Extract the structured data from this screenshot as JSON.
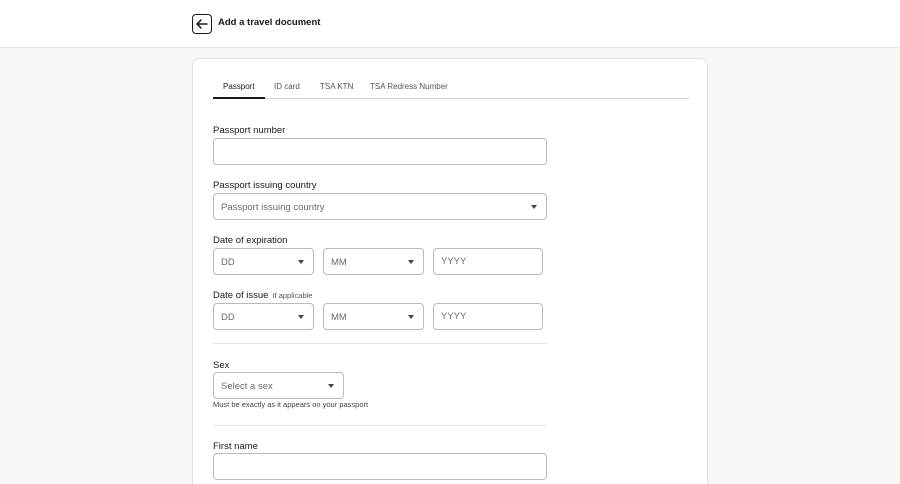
{
  "header": {
    "back_icon": "arrow-left-icon",
    "title": "Add a travel document"
  },
  "tabs": [
    {
      "label": "Passport",
      "active": true
    },
    {
      "label": "ID card",
      "active": false
    },
    {
      "label": "TSA KTN",
      "active": false
    },
    {
      "label": "TSA Redress Number",
      "active": false
    }
  ],
  "form": {
    "passport_number": {
      "label": "Passport number",
      "value": ""
    },
    "issuing_country": {
      "label": "Passport issuing country",
      "selected": "Passport issuing country"
    },
    "expiration": {
      "label": "Date of expiration",
      "day": "DD",
      "month": "MM",
      "year_placeholder": "YYYY"
    },
    "issue": {
      "label": "Date of issue",
      "hint": "If applicable",
      "day": "DD",
      "month": "MM",
      "year_placeholder": "YYYY"
    },
    "sex": {
      "label": "Sex",
      "selected": "Select a sex",
      "helper": "Must be exactly as it appears on your passport"
    },
    "first_name": {
      "label": "First name",
      "value": ""
    }
  },
  "colors": {
    "background": "#f8f7f3",
    "text": "#1a1a1a",
    "border": "#b9b9b9"
  }
}
